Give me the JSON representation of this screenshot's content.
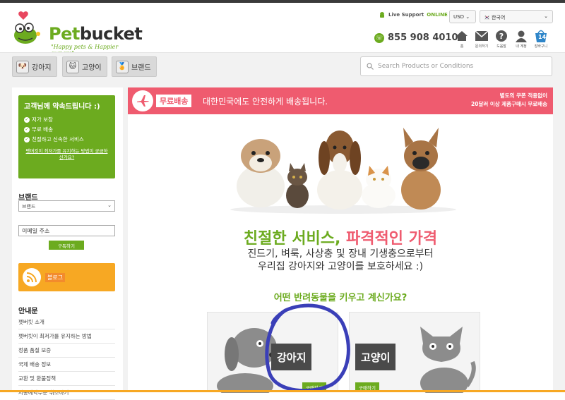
{
  "header": {
    "logo_text_a": "Pet",
    "logo_text_b": "bucket",
    "tagline": "\"Happy pets & Happier owners\"",
    "live_label": "Live Support",
    "live_status": "ONLINE",
    "currency": "USD",
    "language": "한국어",
    "phone": "855 908 4010",
    "icons": [
      {
        "name": "home-icon",
        "label": "홈"
      },
      {
        "name": "mail-icon",
        "label": "문의하기"
      },
      {
        "name": "help-icon",
        "label": "도움말"
      },
      {
        "name": "account-icon",
        "label": "내 계정"
      },
      {
        "name": "cart-icon",
        "label": "장바구니",
        "count": "14"
      }
    ]
  },
  "nav": {
    "items": [
      "강아지",
      "고양이",
      "브랜드"
    ],
    "search_placeholder": "Search Products or Conditions"
  },
  "sidebar": {
    "promise_title": "고객님께 약속드립니다 :)",
    "promise_items": [
      "저가 보장",
      "무료 배송",
      "친절하고 신속한 서비스"
    ],
    "promise_link": "펫버킷이 최저가를 유지하는 방법이 궁금하신가요?",
    "brand_label": "브랜드",
    "brand_select": "브랜드",
    "email_value": "이메일 주소",
    "subscribe": "구독하기",
    "blog": "블로그",
    "guide_title": "안내문",
    "guide_items": [
      "펫버킷 소개",
      "펫버킷이 최저가를 유지하는 방법",
      "정품 품질 보증",
      "국제 배송 정보",
      "교환 및 환불정책",
      "자동예약주문 취소하기"
    ]
  },
  "main": {
    "banner_badge": "무료배송",
    "banner_text": "대한민국에도 안전하게 배송됩니다.",
    "banner_right_1": "별도의 쿠폰 적용없이",
    "banner_right_2": "20달러 이상 제품구매시 무료배송",
    "slogan_a": "친절한 서비스,",
    "slogan_b": "파격적인 가격",
    "sub_1": "진드기, 벼룩, 사상충 및 장내 기생충으로부터",
    "sub_2": "우리집 강아지와 고양이를 보호하세요 :)",
    "question": "어떤 반려동물을 키우고 계신가요?",
    "cards": [
      {
        "label": "강아지",
        "buy": "구매하기"
      },
      {
        "label": "고양이",
        "buy": "구매하기"
      }
    ]
  },
  "colors": {
    "brand_green": "#6cab1f",
    "banner_pink": "#ef5b6f",
    "blog_orange": "#f7a823",
    "annotation_blue": "#3a3fb8"
  }
}
